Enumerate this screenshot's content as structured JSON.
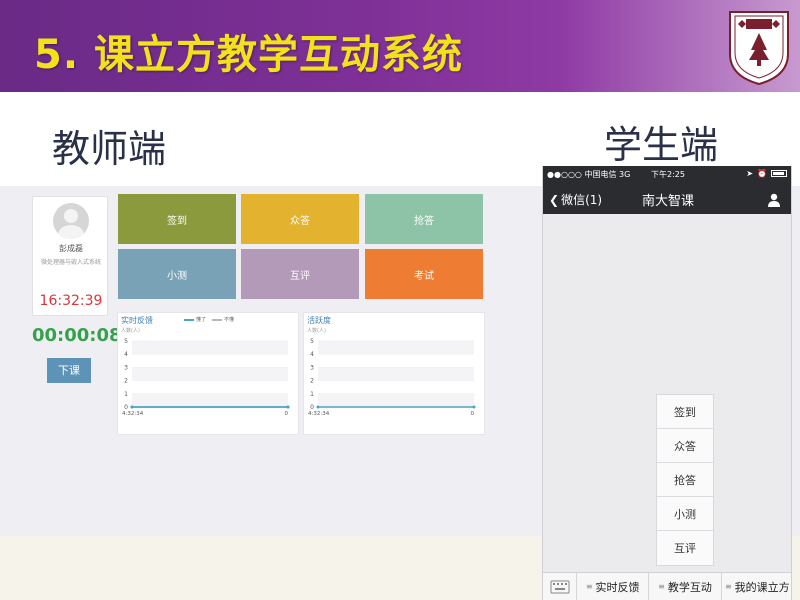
{
  "slide": {
    "title": "5. 课立方教学互动系统",
    "teacher_label": "教师端",
    "student_label": "学生端"
  },
  "teacher": {
    "profile": {
      "name": "彭成磊",
      "course": "微处理器与嵌入式系统",
      "clock": "16:32:39"
    },
    "timer": "00:00:08",
    "end_class_label": "下课",
    "tiles": [
      {
        "label": "签到",
        "color": "#8b9a3c"
      },
      {
        "label": "众答",
        "color": "#e3b22e"
      },
      {
        "label": "抢答",
        "color": "#8dc3a7"
      },
      {
        "label": "小测",
        "color": "#7aa2b6"
      },
      {
        "label": "互评",
        "color": "#b39ab9"
      },
      {
        "label": "考试",
        "color": "#ee7d33"
      }
    ],
    "feedback_panel": {
      "title": "实时反馈",
      "unit": "人数(人)",
      "legend": [
        {
          "name": "懂了",
          "color": "#4aa6b8"
        },
        {
          "name": "不懂",
          "color": "#b8b8b8"
        }
      ],
      "y_ticks": [
        "5",
        "4",
        "3",
        "2",
        "1",
        "0"
      ],
      "x_start": "4:32:34",
      "x_end": "0"
    },
    "activity_panel": {
      "title": "活跃度",
      "unit": "人数(人)",
      "y_ticks": [
        "5",
        "4",
        "3",
        "2",
        "1",
        "0"
      ],
      "x_start": "4:32:34",
      "x_end": "0"
    }
  },
  "phone": {
    "carrier": "●●○○○ 中国电信  3G",
    "time": "下午2:25",
    "nav_back": "微信(1)",
    "nav_title": "南大智课",
    "menu": [
      "签到",
      "众答",
      "抢答",
      "小测",
      "互评"
    ],
    "tabs": [
      "实时反馈",
      "教学互动",
      "我的课立方"
    ]
  },
  "chart_data": [
    {
      "type": "line",
      "title": "实时反馈",
      "ylabel": "人数(人)",
      "ylim": [
        0,
        5
      ],
      "x": [
        "4:32:34",
        "0"
      ],
      "series": [
        {
          "name": "懂了",
          "values": [
            0,
            0
          ]
        },
        {
          "name": "不懂",
          "values": [
            0,
            0
          ]
        }
      ],
      "grid": true,
      "legend": "top"
    },
    {
      "type": "line",
      "title": "活跃度",
      "ylabel": "人数(人)",
      "ylim": [
        0,
        5
      ],
      "x": [
        "4:32:34",
        "0"
      ],
      "series": [
        {
          "values": [
            0,
            0
          ]
        }
      ],
      "grid": true
    }
  ]
}
